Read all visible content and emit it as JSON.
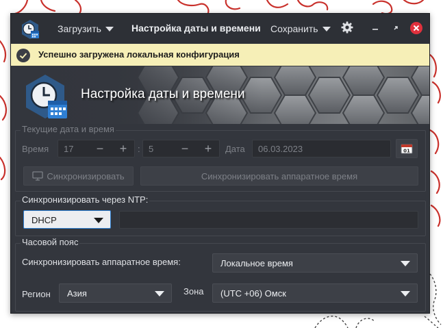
{
  "header": {
    "load_label": "Загрузить",
    "title": "Настройка даты и времени",
    "save_label": "Сохранить"
  },
  "infobar": {
    "message": "Успешно загружена локальная конфигурация"
  },
  "banner": {
    "title": "Настройка даты и времени"
  },
  "datetime": {
    "group_title": "Текущие дата и время",
    "time_label": "Время",
    "hours": "17",
    "minutes": "5",
    "separator": ":",
    "minus": "−",
    "plus": "+",
    "date_label": "Дата",
    "date_value": "06.03.2023",
    "calendar_day": "01",
    "sync_label": "Синхронизировать",
    "sync_hw_label": "Синхронизировать аппаратное время"
  },
  "ntp": {
    "group_title": "Синхронизировать через NTP:",
    "mode_value": "DHCP",
    "server_value": ""
  },
  "timezone": {
    "group_title": "Часовой пояс",
    "hw_label": "Синхронизировать аппаратное время:",
    "hw_value": "Локальное время",
    "region_label": "Регион",
    "region_value": "Азия",
    "zone_label": "Зона",
    "zone_value": "(UTC +06) Омск"
  },
  "colors": {
    "window_bg": "#33363d",
    "header_bg": "#2d3036",
    "info_bg": "#f6efb7",
    "close_red": "#e0313d",
    "accent_blue": "#2f7fd3"
  }
}
